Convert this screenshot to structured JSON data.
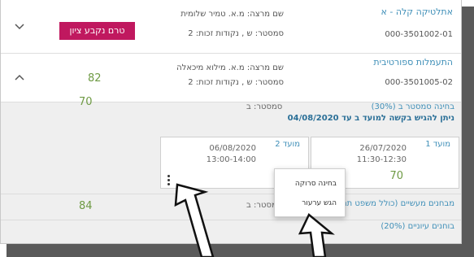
{
  "courses": [
    {
      "name": "אתלטיקה קלה - א",
      "code": "000-3501002-01",
      "lecturer": "שם מרצה:  מ.א. טמיר שלומית",
      "semester_line": "סמסטר:  ש , נקודות זכות:  2",
      "badge": "טרם נקבע ציון",
      "expanded": false
    },
    {
      "name": "התעמלות ספורטיבית",
      "code": "000-3501005-02",
      "lecturer": "שם מרצה:  מ.א. מילוא מיכאלה",
      "semester_line": "סמסטר:  ש , נקודות זכות:  2",
      "grade": "82",
      "expanded": true
    }
  ],
  "details": {
    "exam": {
      "title": "בחינה סמסטר ב (30%)",
      "appeal_notice": "ניתן להגיש בקשה למועד ב עד 04/08/2020",
      "semester": "סמסטר:  ב",
      "grade": "70"
    },
    "moed1": {
      "label": "מועד 1",
      "date": "26/07/2020",
      "time": "11:30-12:30",
      "grade": "70"
    },
    "moed2": {
      "label": "מועד 2",
      "date": "06/08/2020",
      "time": "13:00-14:00"
    },
    "quiz": {
      "title": "מבחנים מעשיים (כולל משפט תנועה)",
      "semester": "סמסטר:  ב",
      "grade": "84"
    },
    "cut_row_label": "בוחנים עיוניים (20%)"
  },
  "menu": {
    "items": [
      "בחינה סרוקה",
      "הגש ערעור"
    ]
  },
  "colors": {
    "link": "#3f8fb8",
    "badge": "#c0185f",
    "grade": "#6e9a44",
    "shadow": "#5a5a5a"
  }
}
